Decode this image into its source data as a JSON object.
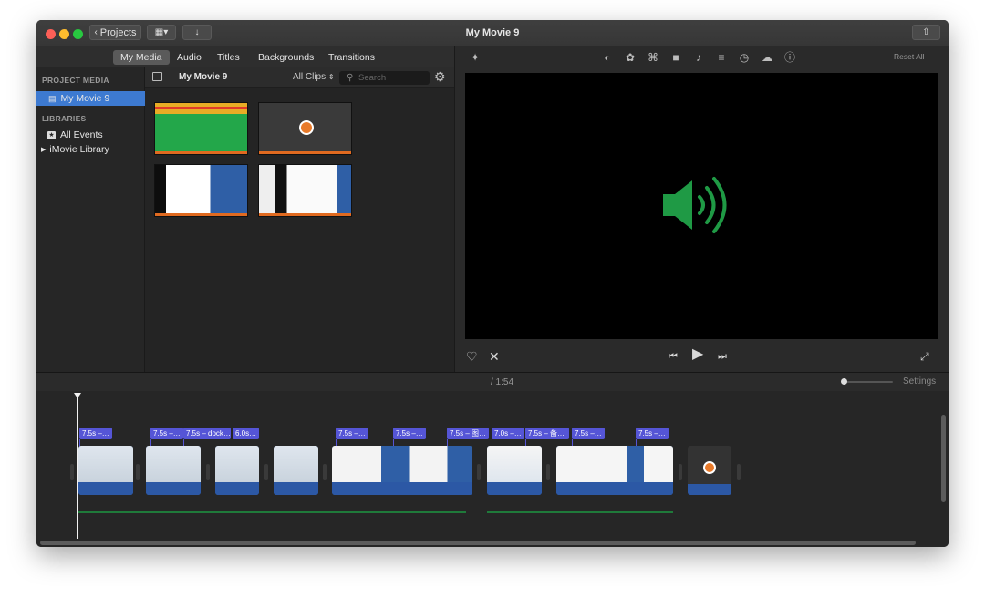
{
  "window": {
    "title": "My Movie 9"
  },
  "titlebar": {
    "projects_label": "Projects",
    "share_icon": "share-icon"
  },
  "tabs": [
    {
      "label": "My Media",
      "active": true
    },
    {
      "label": "Audio",
      "active": false
    },
    {
      "label": "Titles",
      "active": false
    },
    {
      "label": "Backgrounds",
      "active": false
    },
    {
      "label": "Transitions",
      "active": false
    }
  ],
  "sidebar": {
    "project_media_header": "PROJECT MEDIA",
    "project_item": "My Movie 9",
    "libraries_header": "LIBRARIES",
    "all_events": "All Events",
    "library": "iMovie Library"
  },
  "browser": {
    "title": "My Movie 9",
    "filter": "All Clips",
    "search_placeholder": "Search"
  },
  "viewer": {
    "reset_all": "Reset All"
  },
  "timeline": {
    "duration": "/ 1:54",
    "settings": "Settings",
    "labels": [
      "7.5s –…",
      "7.5s –…",
      "7.5s – dock…",
      "6.0s…",
      "7.5s –…",
      "7.5s –…",
      "7.5s – 图…",
      "7.0s –…",
      "7.5s – 备…",
      "7.5s –…",
      "7.5s –…"
    ]
  },
  "colors": {
    "accent": "#3d7ad1",
    "audio_green": "#1f9a45",
    "clip_label": "#5555d6"
  }
}
